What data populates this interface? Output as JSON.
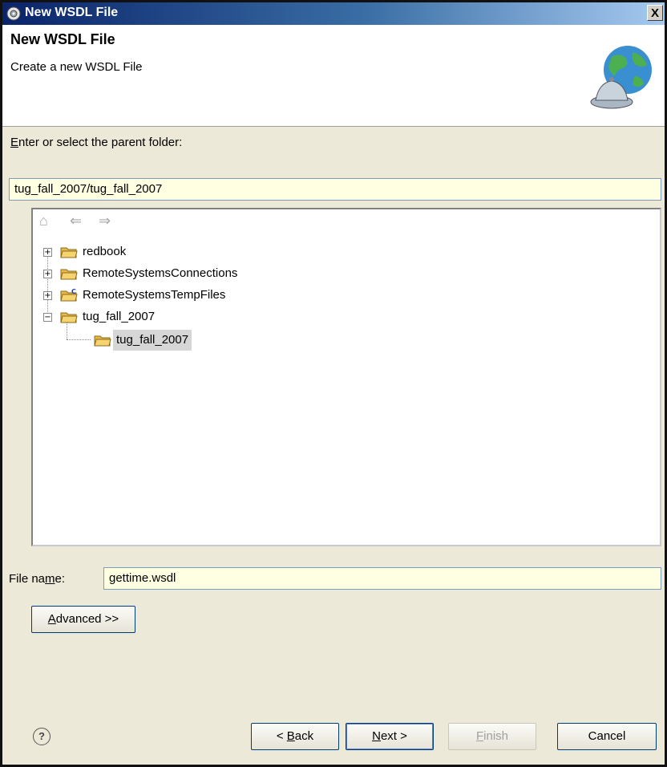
{
  "window": {
    "title": "New WSDL File",
    "close_label": "X"
  },
  "banner": {
    "title": "New WSDL File",
    "subtitle": "Create a new WSDL File"
  },
  "parent_folder": {
    "label_accel": "E",
    "label_rest": "nter or select the parent folder:",
    "value": "tug_fall_2007/tug_fall_2007"
  },
  "tree": {
    "toolbar": {
      "home": "home-icon",
      "back": "back-arrow-icon",
      "forward": "forward-arrow-icon"
    },
    "items": [
      {
        "label": "redbook"
      },
      {
        "label": "RemoteSystemsConnections"
      },
      {
        "label": "RemoteSystemsTempFiles"
      },
      {
        "label": "tug_fall_2007"
      },
      {
        "label": "tug_fall_2007"
      }
    ]
  },
  "file_name": {
    "label_pre": "File na",
    "label_accel": "m",
    "label_post": "e:",
    "value": "gettime.wsdl"
  },
  "advanced": {
    "accel": "A",
    "rest": "dvanced >>"
  },
  "footer": {
    "help": "?",
    "back": {
      "pre": "< ",
      "accel": "B",
      "rest": "ack"
    },
    "next": {
      "accel": "N",
      "rest": "ext >"
    },
    "finish": {
      "accel": "F",
      "rest": "inish"
    },
    "cancel": "Cancel"
  },
  "colors": {
    "field_bg": "#ffffe1",
    "dialog_bg": "#ece9d8",
    "titlebar": "#0a246a",
    "folder": "#e8b84a"
  }
}
